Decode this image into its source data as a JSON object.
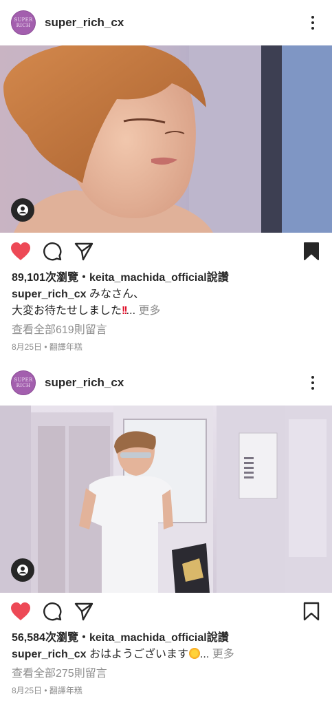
{
  "posts": [
    {
      "username": "super_rich_cx",
      "avatar_text": "SUPER RICH",
      "views_label": "89,101次瀏覽",
      "separator": "・",
      "liked_by": "keita_machida_official",
      "liked_suffix": "說讚",
      "caption_user": "super_rich_cx",
      "caption_line1": "みなさん、",
      "caption_line2": "大変お待たせしました",
      "caption_emoji": "!!",
      "ellipsis": "...",
      "more_label": "更多",
      "comments_label": "查看全部619則留言",
      "date": "8月25日",
      "translate_label": "翻譯年糕",
      "liked": true,
      "saved": true
    },
    {
      "username": "super_rich_cx",
      "avatar_text": "SUPER RICH",
      "views_label": "56,584次瀏覽",
      "separator": "・",
      "liked_by": "keita_machida_official",
      "liked_suffix": "說讚",
      "caption_user": "super_rich_cx",
      "caption_line1": "おはようございます",
      "ellipsis": "...",
      "more_label": "更多",
      "comments_label": "查看全部275則留言",
      "date": "8月25日",
      "translate_label": "翻譯年糕",
      "liked": true,
      "saved": false
    }
  ],
  "colors": {
    "like_red": "#ed4956",
    "text": "#262626",
    "muted": "#8e8e8e",
    "avatar_purple": "#a35fae"
  },
  "icons": [
    "heart-icon",
    "comment-icon",
    "share-icon",
    "bookmark-icon",
    "more-icon",
    "user-tag-icon"
  ]
}
